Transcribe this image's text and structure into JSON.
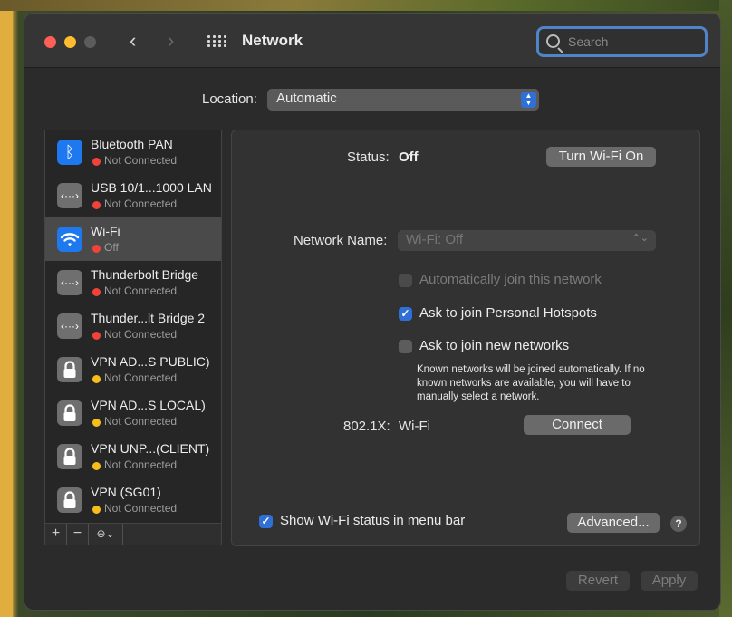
{
  "window": {
    "title": "Network"
  },
  "search": {
    "placeholder": "Search"
  },
  "location": {
    "label": "Location:",
    "value": "Automatic"
  },
  "services": [
    {
      "name": "Bluetooth PAN",
      "status": "Not Connected",
      "status_color": "#f2433a",
      "icon": "bluetooth-icon"
    },
    {
      "name": "USB 10/1...1000 LAN",
      "status": "Not Connected",
      "status_color": "#f2433a",
      "icon": "ethernet-icon"
    },
    {
      "name": "Wi-Fi",
      "status": "Off",
      "status_color": "#f2433a",
      "icon": "wifi-icon",
      "selected": true
    },
    {
      "name": "Thunderbolt Bridge",
      "status": "Not Connected",
      "status_color": "#f2433a",
      "icon": "ethernet-icon"
    },
    {
      "name": "Thunder...lt Bridge 2",
      "status": "Not Connected",
      "status_color": "#f2433a",
      "icon": "ethernet-icon"
    },
    {
      "name": "VPN AD...S PUBLIC)",
      "status": "Not Connected",
      "status_color": "#f6bd1b",
      "icon": "lock-icon"
    },
    {
      "name": "VPN AD...S LOCAL)",
      "status": "Not Connected",
      "status_color": "#f6bd1b",
      "icon": "lock-icon"
    },
    {
      "name": "VPN UNP...(CLIENT)",
      "status": "Not Connected",
      "status_color": "#f6bd1b",
      "icon": "lock-icon"
    },
    {
      "name": "VPN (SG01)",
      "status": "Not Connected",
      "status_color": "#f6bd1b",
      "icon": "lock-icon"
    }
  ],
  "sidebar_toolbar": {
    "add": "+",
    "remove": "−",
    "action": "⊖⌄"
  },
  "detail": {
    "status_label": "Status:",
    "status_value": "Off",
    "wifi_button": "Turn Wi-Fi On",
    "network_name_label": "Network Name:",
    "network_name_value": "Wi-Fi: Off",
    "auto_join_label": "Automatically join this network",
    "personal_hotspots_label": "Ask to join Personal Hotspots",
    "personal_hotspots_checked": true,
    "new_networks_label": "Ask to join new networks",
    "new_networks_checked": false,
    "note": "Known networks will be joined automatically. If no known networks are available, you will have to manually select a network.",
    "dot1x_label": "802.1X:",
    "dot1x_value": "Wi-Fi",
    "connect_button": "Connect",
    "show_status_label": "Show Wi-Fi status in menu bar",
    "show_status_checked": true,
    "advanced_button": "Advanced...",
    "help": "?"
  },
  "footer": {
    "revert": "Revert",
    "apply": "Apply"
  }
}
